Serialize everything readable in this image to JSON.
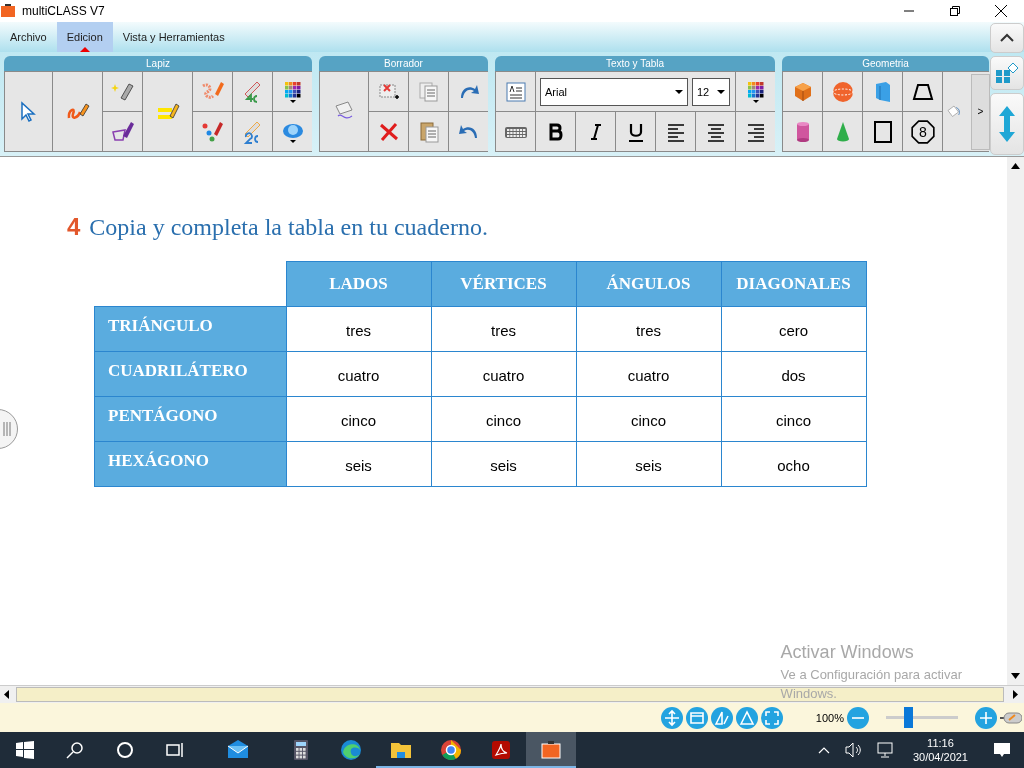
{
  "window": {
    "title": "multiCLASS V7"
  },
  "menu": [
    {
      "label": "Archivo",
      "selected": false
    },
    {
      "label": "Edicion",
      "selected": true
    },
    {
      "label": "Vista y Herramientas",
      "selected": false
    }
  ],
  "toolbar": {
    "groups": [
      {
        "kind": "pen",
        "title": "Lapiz"
      },
      {
        "kind": "eraser",
        "title": "Borrador"
      },
      {
        "kind": "text",
        "title": "Texto y Tabla",
        "font": "Arial",
        "size": "12"
      },
      {
        "kind": "geometry",
        "title": "Geometria",
        "octagon": "8",
        "more": ">"
      }
    ]
  },
  "exercise": {
    "number": "4",
    "instruction": "Copia y completa la tabla en tu cuaderno."
  },
  "table": {
    "columns": [
      "LADOS",
      "VÉRTICES",
      "ÁNGULOS",
      "DIAGONALES"
    ],
    "rows": [
      {
        "label": "TRIÁNGULO",
        "cells": [
          "tres",
          "tres",
          "tres",
          "cero"
        ]
      },
      {
        "label": "CUADRILÁTERO",
        "cells": [
          "cuatro",
          "cuatro",
          "cuatro",
          "dos"
        ]
      },
      {
        "label": "PENTÁGONO",
        "cells": [
          "cinco",
          "cinco",
          "cinco",
          "cinco"
        ]
      },
      {
        "label": "HEXÁGONO",
        "cells": [
          "seis",
          "seis",
          "seis",
          "ocho"
        ]
      }
    ]
  },
  "activation": [
    "Activar Windows",
    "Ve a Configuración para activar",
    "Windows."
  ],
  "zoom": {
    "value": "100%",
    "level": 0.3
  },
  "taskbar": {
    "apps": [
      {
        "kind": "mail",
        "running": false,
        "selected": false
      },
      {
        "kind": "calculator",
        "running": false,
        "selected": false
      },
      {
        "kind": "browser-edge",
        "running": false,
        "selected": false
      },
      {
        "kind": "folder",
        "running": true,
        "selected": false
      },
      {
        "kind": "browser-chrome",
        "running": true,
        "selected": false
      },
      {
        "kind": "pdf",
        "running": true,
        "selected": false
      },
      {
        "kind": "book",
        "running": true,
        "selected": true
      }
    ],
    "time": "11:16",
    "date": "30/04/2021"
  }
}
